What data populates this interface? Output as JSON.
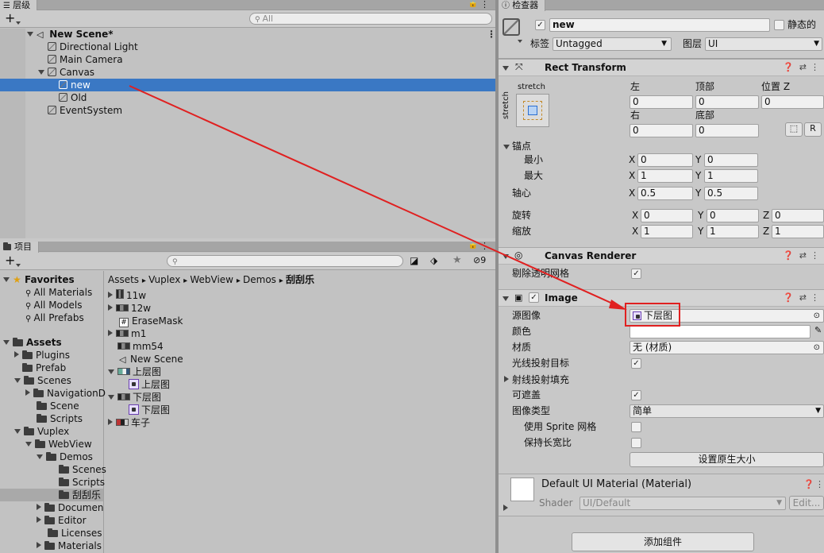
{
  "hierarchy": {
    "tab": "层级",
    "search_placeholder": "All",
    "scene": "New Scene*",
    "items": [
      {
        "label": "Directional Light"
      },
      {
        "label": "Main Camera"
      },
      {
        "label": "Canvas"
      },
      {
        "label": "new"
      },
      {
        "label": "Old"
      },
      {
        "label": "EventSystem"
      }
    ]
  },
  "project": {
    "tab": "项目",
    "hidden_count": "9",
    "favorites": {
      "title": "Favorites",
      "items": [
        "All Materials",
        "All Models",
        "All Prefabs"
      ]
    },
    "assets_title": "Assets",
    "tree": [
      "Plugins",
      "Prefab",
      "Scenes",
      "NavigationD",
      "Scene",
      "Scripts",
      "Vuplex",
      "WebView",
      "Demos",
      "Scenes",
      "Scripts",
      "刮刮乐",
      "Documen",
      "Editor",
      "Licenses",
      "Materials"
    ],
    "breadcrumb": [
      "Assets",
      "Vuplex",
      "WebView",
      "Demos",
      "刮刮乐"
    ],
    "files": [
      "11w",
      "12w",
      "EraseMask",
      "m1",
      "mm54",
      "New Scene",
      "上层图",
      "上层图",
      "下层图",
      "下层图",
      "车子"
    ]
  },
  "inspector": {
    "tab": "检查器",
    "object_name": "new",
    "static_label": "静态的",
    "tag_label": "标签",
    "tag_value": "Untagged",
    "layer_label": "图层",
    "layer_value": "UI",
    "rect": {
      "title": "Rect Transform",
      "stretch_top": "stretch",
      "stretch_side": "stretch",
      "left_label": "左",
      "top_label": "顶部",
      "posz_label": "位置 Z",
      "left": "0",
      "top": "0",
      "posz": "0",
      "right_label": "右",
      "bottom_label": "底部",
      "right": "0",
      "bottom": "0",
      "r_btn": "R",
      "anchors_label": "锚点",
      "min_label": "最小",
      "max_label": "最大",
      "min_x": "0",
      "min_y": "0",
      "max_x": "1",
      "max_y": "1",
      "pivot_label": "轴心",
      "pivot_x": "0.5",
      "pivot_y": "0.5",
      "rotation_label": "旋转",
      "rot_x": "0",
      "rot_y": "0",
      "rot_z": "0",
      "scale_label": "缩放",
      "scale_x": "1",
      "scale_y": "1",
      "scale_z": "1",
      "x": "X",
      "y": "Y",
      "z": "Z"
    },
    "canvas_renderer": {
      "title": "Canvas Renderer",
      "cull_label": "剔除透明网格"
    },
    "image": {
      "title": "Image",
      "source_label": "源图像",
      "source_value": "下层图",
      "color_label": "颜色",
      "material_label": "材质",
      "material_value": "无 (材质)",
      "raycast_label": "光线投射目标",
      "raycast_padding_label": "射线投射填充",
      "maskable_label": "可遮盖",
      "type_label": "图像类型",
      "type_value": "简单",
      "sprite_mesh_label": "使用 Sprite 网格",
      "preserve_label": "保持长宽比",
      "native_btn": "设置原生大小"
    },
    "material": {
      "title": "Default UI Material (Material)",
      "shader_label": "Shader",
      "shader_value": "UI/Default",
      "edit": "Edit..."
    },
    "add_component": "添加组件"
  },
  "colors": {
    "selection": "#3a78c4",
    "annotation": "#e02020"
  }
}
